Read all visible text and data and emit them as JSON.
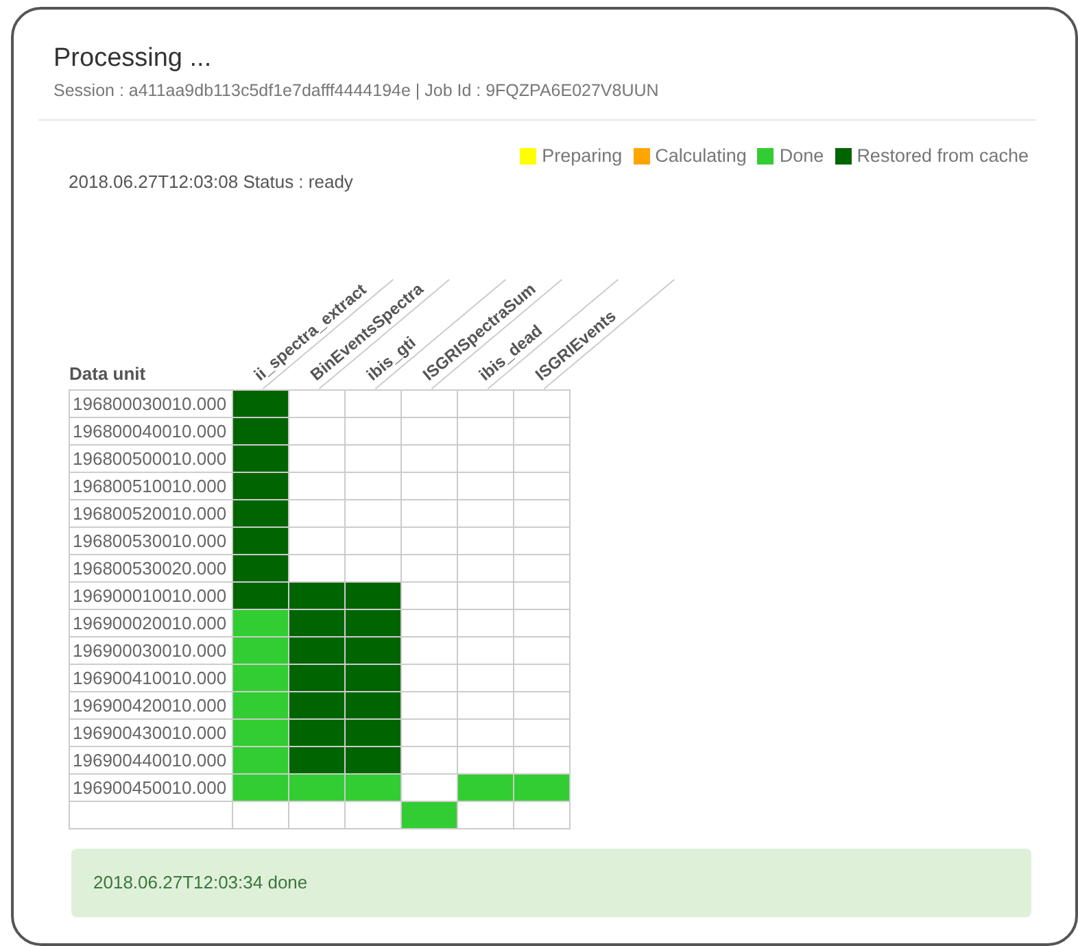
{
  "title": "Processing ...",
  "subtitle": "Session : a411aa9db113c5df1e7dafff4444194e | Job Id : 9FQZPA6E027V8UUN",
  "legend": [
    {
      "label": "Preparing",
      "color": "#ffff00"
    },
    {
      "label": "Calculating",
      "color": "#ffa500"
    },
    {
      "label": "Done",
      "color": "#32cd32"
    },
    {
      "label": "Restored from cache",
      "color": "#006400"
    }
  ],
  "status": "2018.06.27T12:03:08 Status : ready",
  "table": {
    "row_header": "Data unit",
    "columns": [
      "ii_spectra_extract",
      "BinEventsSpectra",
      "ibis_gti",
      "ISGRISpectraSum",
      "ibis_dead",
      "ISGRIEvents"
    ],
    "rows": [
      {
        "label": "196800030010.000",
        "cells": [
          {
            "color": "#006400"
          },
          {
            "color": "#ffffff"
          },
          {
            "color": "#ffffff"
          },
          {
            "color": "#ffffff"
          },
          {
            "color": "#ffffff"
          },
          {
            "color": "#ffffff"
          }
        ]
      },
      {
        "label": "196800040010.000",
        "cells": [
          {
            "color": "#006400"
          },
          {
            "color": "#ffffff"
          },
          {
            "color": "#ffffff"
          },
          {
            "color": "#ffffff"
          },
          {
            "color": "#ffffff"
          },
          {
            "color": "#ffffff"
          }
        ]
      },
      {
        "label": "196800500010.000",
        "cells": [
          {
            "color": "#006400"
          },
          {
            "color": "#ffffff"
          },
          {
            "color": "#ffffff"
          },
          {
            "color": "#ffffff"
          },
          {
            "color": "#ffffff"
          },
          {
            "color": "#ffffff"
          }
        ]
      },
      {
        "label": "196800510010.000",
        "cells": [
          {
            "color": "#006400"
          },
          {
            "color": "#ffffff"
          },
          {
            "color": "#ffffff"
          },
          {
            "color": "#ffffff"
          },
          {
            "color": "#ffffff"
          },
          {
            "color": "#ffffff"
          }
        ]
      },
      {
        "label": "196800520010.000",
        "cells": [
          {
            "color": "#006400"
          },
          {
            "color": "#ffffff"
          },
          {
            "color": "#ffffff"
          },
          {
            "color": "#ffffff"
          },
          {
            "color": "#ffffff"
          },
          {
            "color": "#ffffff"
          }
        ]
      },
      {
        "label": "196800530010.000",
        "cells": [
          {
            "color": "#006400"
          },
          {
            "color": "#ffffff"
          },
          {
            "color": "#ffffff"
          },
          {
            "color": "#ffffff"
          },
          {
            "color": "#ffffff"
          },
          {
            "color": "#ffffff"
          }
        ]
      },
      {
        "label": "196800530020.000",
        "cells": [
          {
            "color": "#006400"
          },
          {
            "color": "#ffffff"
          },
          {
            "color": "#ffffff"
          },
          {
            "color": "#ffffff"
          },
          {
            "color": "#ffffff"
          },
          {
            "color": "#ffffff"
          }
        ]
      },
      {
        "label": "196900010010.000",
        "cells": [
          {
            "color": "#006400"
          },
          {
            "color": "#006400"
          },
          {
            "color": "#006400"
          },
          {
            "color": "#ffffff"
          },
          {
            "color": "#ffffff"
          },
          {
            "color": "#ffffff"
          }
        ]
      },
      {
        "label": "196900020010.000",
        "cells": [
          {
            "color": "#32cd32"
          },
          {
            "color": "#006400"
          },
          {
            "color": "#006400"
          },
          {
            "color": "#ffffff"
          },
          {
            "color": "#ffffff"
          },
          {
            "color": "#ffffff"
          }
        ]
      },
      {
        "label": "196900030010.000",
        "cells": [
          {
            "color": "#32cd32"
          },
          {
            "color": "#006400"
          },
          {
            "color": "#006400"
          },
          {
            "color": "#ffffff"
          },
          {
            "color": "#ffffff"
          },
          {
            "color": "#ffffff"
          }
        ]
      },
      {
        "label": "196900410010.000",
        "cells": [
          {
            "color": "#32cd32"
          },
          {
            "color": "#006400"
          },
          {
            "color": "#006400"
          },
          {
            "color": "#ffffff"
          },
          {
            "color": "#ffffff"
          },
          {
            "color": "#ffffff"
          }
        ]
      },
      {
        "label": "196900420010.000",
        "cells": [
          {
            "color": "#32cd32"
          },
          {
            "color": "#006400"
          },
          {
            "color": "#006400"
          },
          {
            "color": "#ffffff"
          },
          {
            "color": "#ffffff"
          },
          {
            "color": "#ffffff"
          }
        ]
      },
      {
        "label": "196900430010.000",
        "cells": [
          {
            "color": "#32cd32"
          },
          {
            "color": "#006400"
          },
          {
            "color": "#006400"
          },
          {
            "color": "#ffffff"
          },
          {
            "color": "#ffffff"
          },
          {
            "color": "#ffffff"
          }
        ]
      },
      {
        "label": "196900440010.000",
        "cells": [
          {
            "color": "#32cd32"
          },
          {
            "color": "#006400"
          },
          {
            "color": "#006400"
          },
          {
            "color": "#ffffff"
          },
          {
            "color": "#ffffff"
          },
          {
            "color": "#ffffff"
          }
        ]
      },
      {
        "label": "196900450010.000",
        "cells": [
          {
            "color": "#32cd32"
          },
          {
            "color": "#32cd32"
          },
          {
            "color": "#32cd32"
          },
          {
            "color": "#ffffff"
          },
          {
            "color": "#32cd32"
          },
          {
            "color": "#32cd32"
          }
        ]
      },
      {
        "cells": [
          {
            "color": "#ffffff"
          },
          {
            "color": "#ffffff"
          },
          {
            "color": "#ffffff"
          },
          {
            "color": "#32cd32"
          },
          {
            "color": "#ffffff"
          },
          {
            "color": "#ffffff"
          }
        ]
      }
    ]
  },
  "done_message": "2018.06.27T12:03:34 done"
}
